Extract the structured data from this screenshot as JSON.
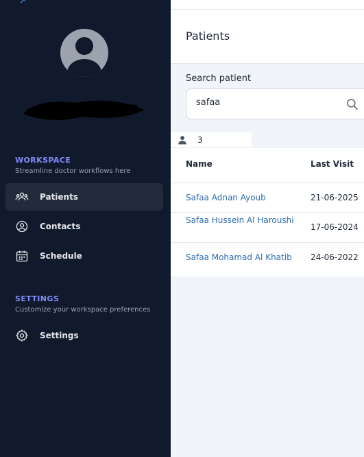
{
  "sidebar": {
    "workspace": {
      "title": "WORKSPACE",
      "subtitle": "Streamline doctor workflows here",
      "items": [
        {
          "label": "Patients",
          "icon": "users-icon",
          "active": true
        },
        {
          "label": "Contacts",
          "icon": "user-circle-icon",
          "active": false
        },
        {
          "label": "Schedule",
          "icon": "calendar-icon",
          "active": false
        }
      ]
    },
    "settings": {
      "title": "SETTINGS",
      "subtitle": "Customize your workspace preferences",
      "items": [
        {
          "label": "Settings",
          "icon": "gear-icon",
          "active": false
        }
      ]
    }
  },
  "header": {
    "title": "Patients"
  },
  "search": {
    "label": "Search patient",
    "value": "safaa"
  },
  "result_count": "3",
  "table": {
    "columns": [
      "Name",
      "Last Visit"
    ],
    "rows": [
      {
        "name": "Safaa Adnan Ayoub",
        "last_visit": "21-06-2025"
      },
      {
        "name": "Safaa Hussein Al Haroushi",
        "last_visit": "17-06-2024"
      },
      {
        "name": "Safaa Mohamad Al Khatib",
        "last_visit": "24-06-2022"
      }
    ]
  },
  "colors": {
    "sidebar_bg": "#111a2c",
    "active_item_bg": "#212b3b",
    "section_title": "#818cf8",
    "link": "#2b6cb0"
  }
}
